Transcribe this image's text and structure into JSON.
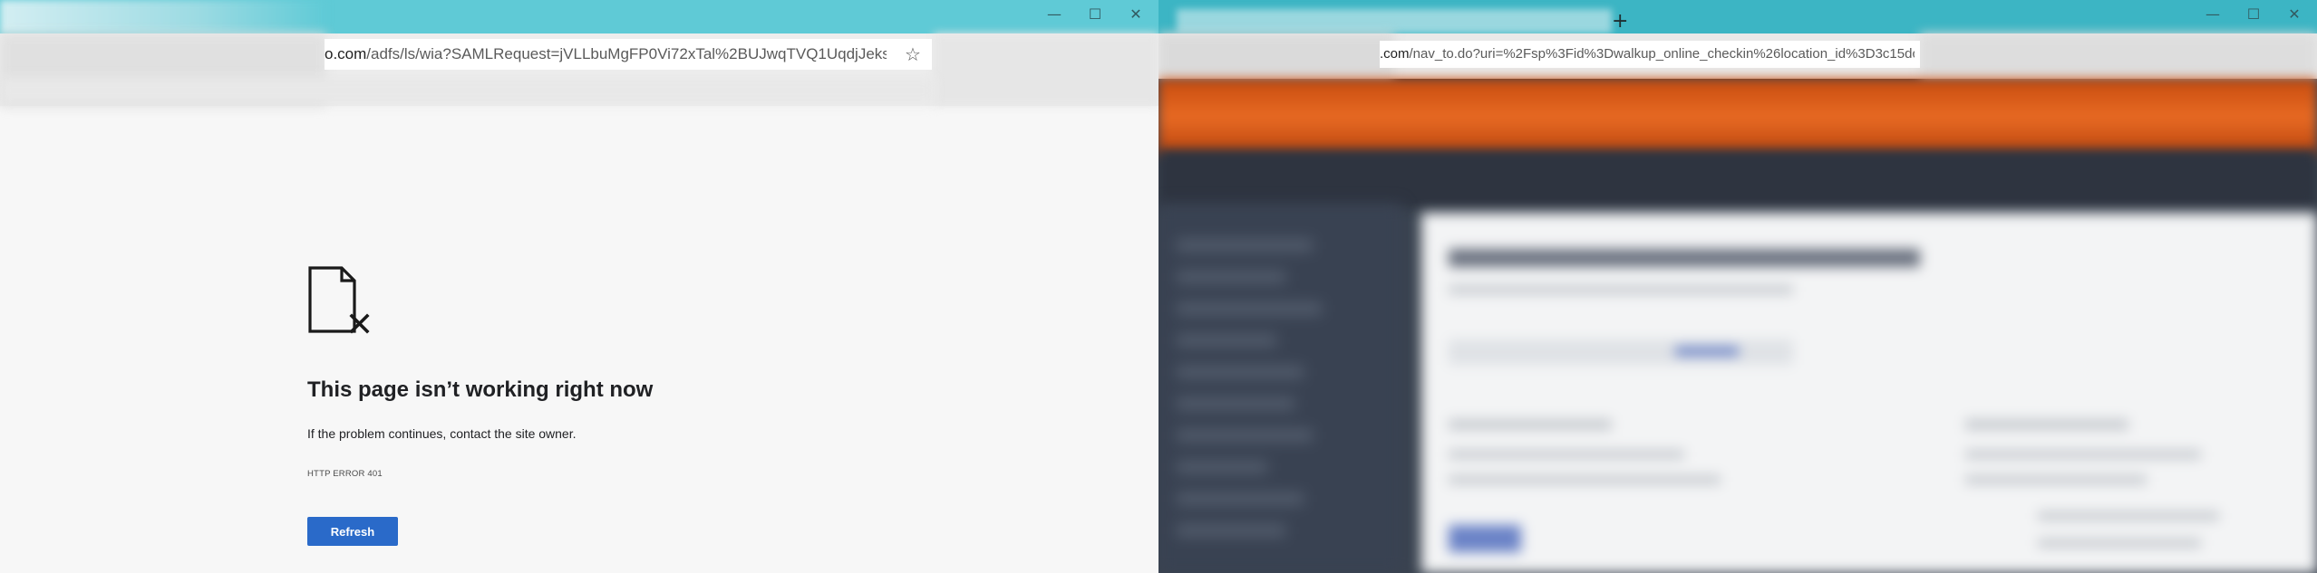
{
  "left_window": {
    "url_domain": "o.com",
    "url_path": "/adfs/ls/wia?SAMLRequest=jVLLbuMgFP0Vi72xTal%2BUJwqTVQ1UqdjJeksZofhOk...",
    "error": {
      "icon": "document-error-icon",
      "title": "This page isn’t working right now",
      "message": "If the problem continues, contact the site owner.",
      "code": "HTTP ERROR 401",
      "refresh_label": "Refresh"
    },
    "window_controls": {
      "minimize": "—",
      "maximize": "☐",
      "close": "✕"
    }
  },
  "right_window": {
    "new_tab_label": "+",
    "url_domain": ".com",
    "url_path": "/nav_to.do?uri=%2Fsp%3Fid%3Dwalkup_online_checkin%26location_id%3D3c15dc2fdb...",
    "window_controls": {
      "minimize": "—",
      "maximize": "☐",
      "close": "✕"
    }
  },
  "colors": {
    "titlebar_left": "#5fcad6",
    "titlebar_right": "#3cb5c4",
    "refresh_button": "#2a6ac9",
    "error_page_bg": "#f7f7f7"
  }
}
